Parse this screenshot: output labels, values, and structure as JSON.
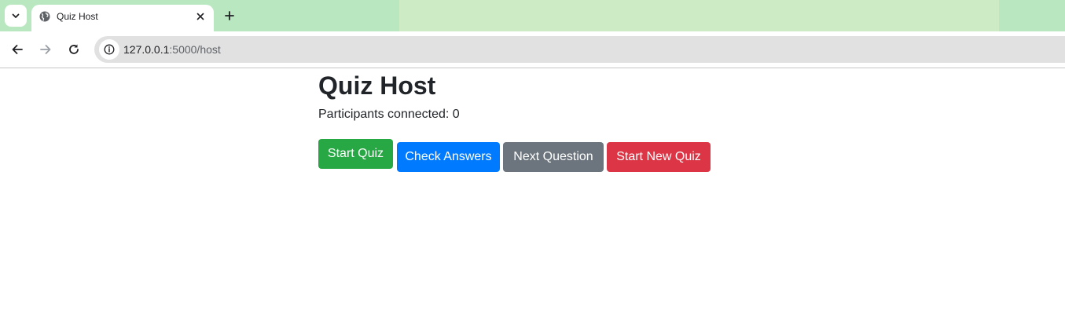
{
  "browser": {
    "tab": {
      "title": "Quiz Host"
    },
    "address": {
      "host": "127.0.0.1",
      "path": ":5000/host"
    }
  },
  "page": {
    "title": "Quiz Host",
    "participants_text": "Participants connected: 0",
    "buttons": {
      "start": "Start Quiz",
      "check": "Check Answers",
      "next": "Next Question",
      "new": "Start New Quiz"
    }
  },
  "colors": {
    "start": "#28a745",
    "check": "#007bff",
    "next": "#6c757d",
    "new": "#dc3545"
  }
}
